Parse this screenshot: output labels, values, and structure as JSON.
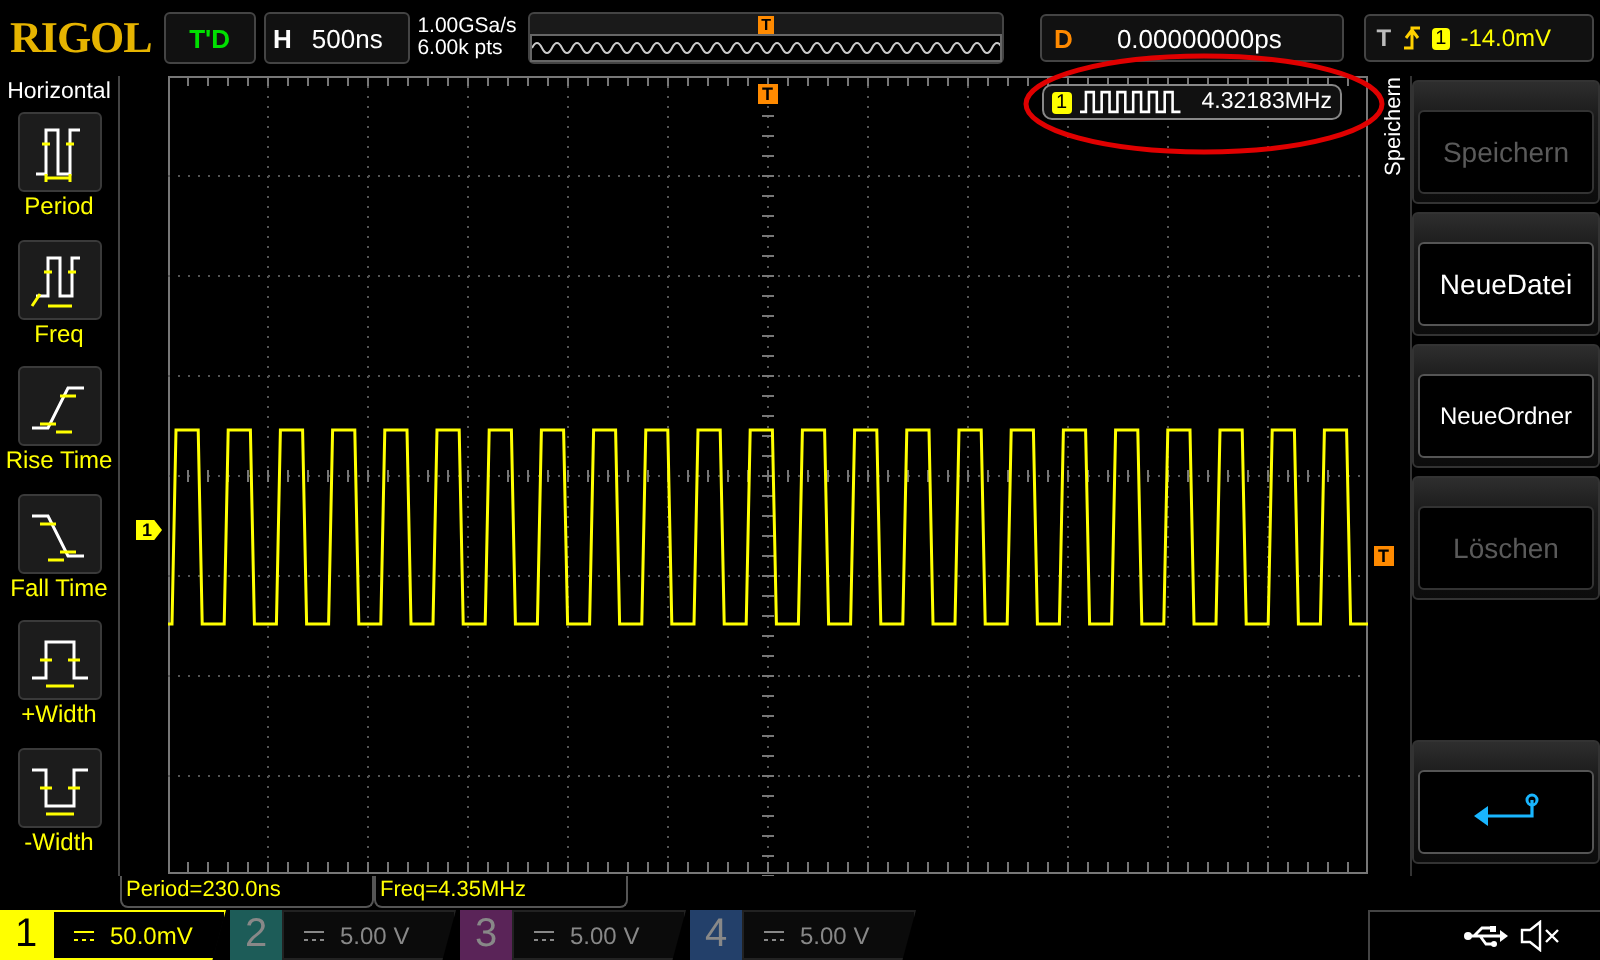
{
  "header": {
    "logo": "RIGOL",
    "run_state": "T'D",
    "timebase_label": "H",
    "timebase": "500ns",
    "sample_rate": "1.00GSa/s",
    "memory_depth": "6.00k pts",
    "overview_marker": "T",
    "delay_label": "D",
    "delay": "0.00000000ps",
    "trigger_label": "T",
    "trigger_channel": "1",
    "trigger_level": "-14.0mV"
  },
  "measure_menu": {
    "title": "Horizontal",
    "items": [
      {
        "label": "Period",
        "kind": "period"
      },
      {
        "label": "Freq",
        "kind": "freq"
      },
      {
        "label": "Rise Time",
        "kind": "rise"
      },
      {
        "label": "Fall Time",
        "kind": "fall"
      },
      {
        "label": "+Width",
        "kind": "pwidth"
      },
      {
        "label": "-Width",
        "kind": "nwidth"
      }
    ]
  },
  "display": {
    "trigger_position_marker": "T",
    "trigger_level_marker": "T",
    "channel_marker": "1",
    "frequency_counter": {
      "channel": "1",
      "value": "4.32183MHz"
    }
  },
  "measurements": [
    "Period=230.0ns",
    "Freq=4.35MHz"
  ],
  "softkeys": {
    "title": "Speichern",
    "items": [
      {
        "kind": "text",
        "label": "Speichern",
        "disabled": true
      },
      {
        "kind": "text",
        "label": "NeueDatei",
        "disabled": false
      },
      {
        "kind": "text",
        "label": "NeueOrdner",
        "disabled": false
      },
      {
        "kind": "text",
        "label": "Löschen",
        "disabled": true
      },
      {
        "kind": "empty"
      },
      {
        "kind": "back"
      }
    ]
  },
  "channels": [
    {
      "number": "1",
      "scale": "50.0mV",
      "on": true,
      "color": "#ffff00"
    },
    {
      "number": "2",
      "scale": "5.00 V",
      "on": false,
      "color": "#1d5c58"
    },
    {
      "number": "3",
      "scale": "5.00 V",
      "on": false,
      "color": "#5a2458"
    },
    {
      "number": "4",
      "scale": "5.00 V",
      "on": false,
      "color": "#23406a"
    }
  ]
}
